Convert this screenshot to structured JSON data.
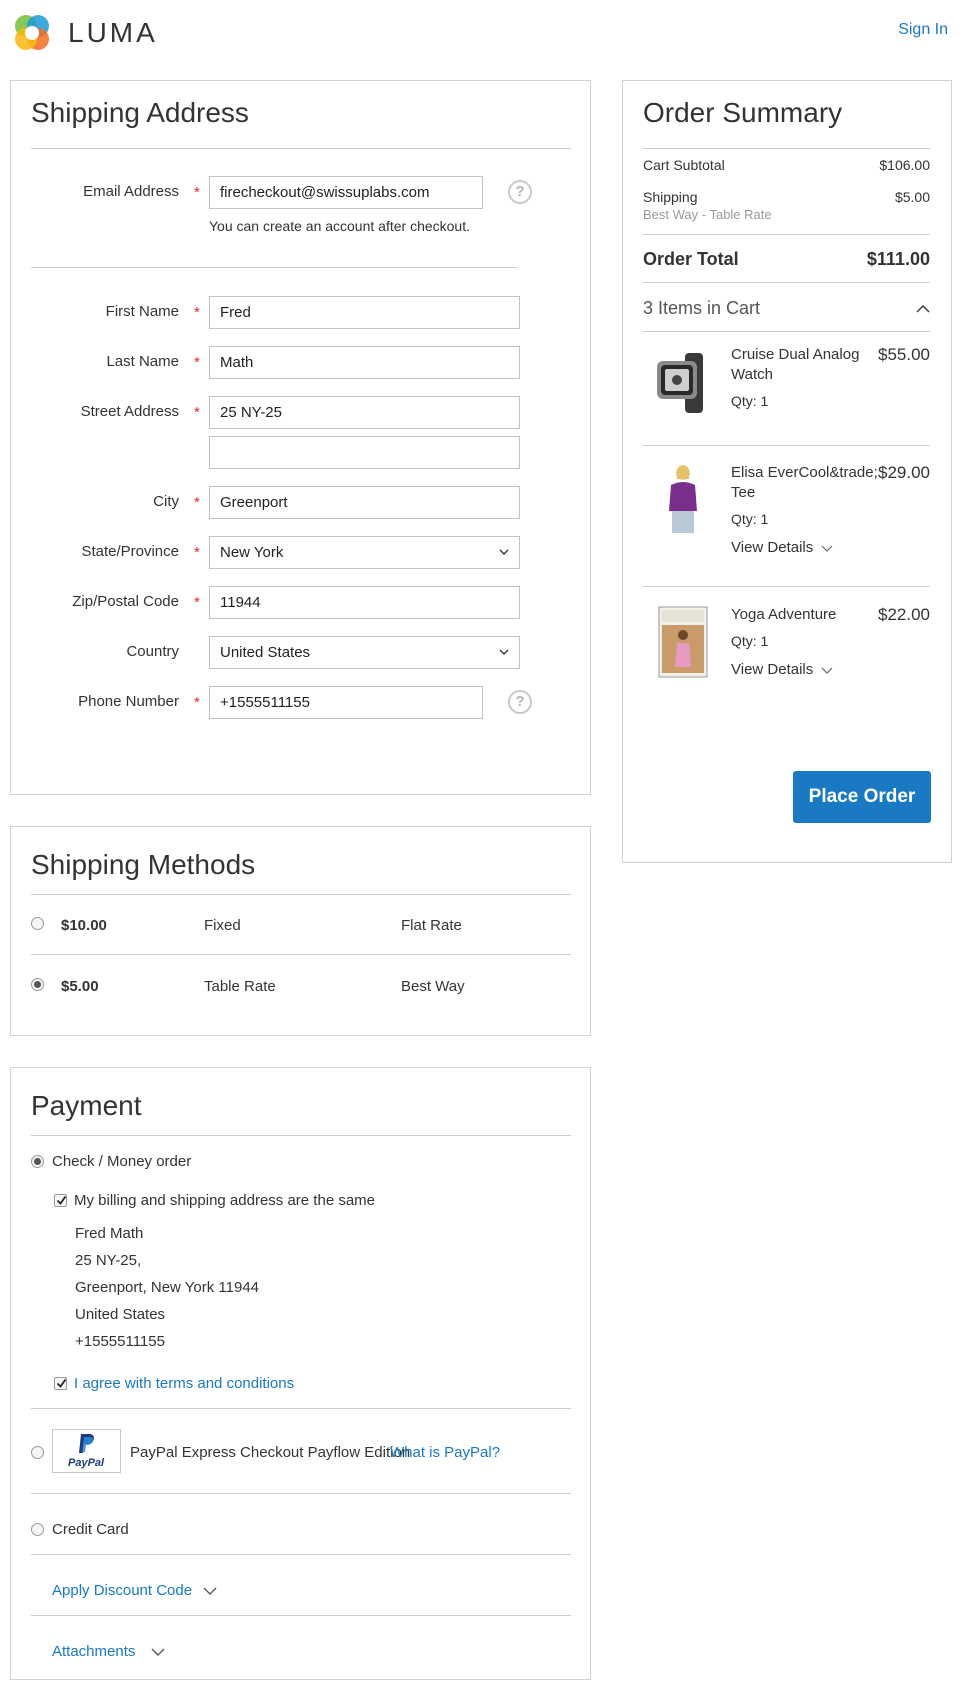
{
  "header": {
    "logo_text": "LUMA",
    "sign_in": "Sign In"
  },
  "colors": {
    "accent": "#1979c3",
    "required": "#e02b27",
    "border": "#d1d1d1"
  },
  "shipping_address": {
    "title": "Shipping Address",
    "email": {
      "label": "Email Address",
      "value": "firecheckout@swissuplabs.com",
      "note": "You can create an account after checkout."
    },
    "first_name": {
      "label": "First Name",
      "value": "Fred"
    },
    "last_name": {
      "label": "Last Name",
      "value": "Math"
    },
    "street": {
      "label": "Street Address",
      "value": "25 NY-25",
      "value2": ""
    },
    "city": {
      "label": "City",
      "value": "Greenport"
    },
    "state": {
      "label": "State/Province",
      "value": "New York"
    },
    "zip": {
      "label": "Zip/Postal Code",
      "value": "11944"
    },
    "country": {
      "label": "Country",
      "value": "United States"
    },
    "phone": {
      "label": "Phone Number",
      "value": "+1555511155"
    },
    "required_mark": "*",
    "help_mark": "?"
  },
  "shipping_methods": {
    "title": "Shipping Methods",
    "methods": [
      {
        "price": "$10.00",
        "method": "Fixed",
        "carrier": "Flat Rate",
        "selected": false
      },
      {
        "price": "$5.00",
        "method": "Table Rate",
        "carrier": "Best Way",
        "selected": true
      }
    ]
  },
  "payment": {
    "title": "Payment",
    "check_money": "Check / Money order",
    "billing_same": "My billing and shipping address are the same",
    "address_lines": [
      "Fred Math",
      "25 NY-25,",
      "Greenport, New York 11944",
      "United States",
      "+1555511155"
    ],
    "terms": "I agree with terms and conditions",
    "paypal_label": "PayPal Express Checkout Payflow Edition",
    "paypal_link": "What is PayPal?",
    "paypal_logo_text": "PayPal",
    "credit_card": "Credit Card",
    "discount": "Apply Discount Code",
    "attachments": "Attachments"
  },
  "order_summary": {
    "title": "Order Summary",
    "cart_subtotal_label": "Cart Subtotal",
    "cart_subtotal": "$106.00",
    "shipping_label": "Shipping",
    "shipping_value": "$5.00",
    "shipping_method": "Best Way - Table Rate",
    "order_total_label": "Order Total",
    "order_total": "$111.00",
    "items_in_cart": "3 Items in Cart",
    "items": [
      {
        "name": "Cruise Dual Analog Watch",
        "price": "$55.00",
        "qty": "Qty: 1",
        "icon": "watch-thumbnail"
      },
      {
        "name": "Elisa EverCool&trade; Tee",
        "price": "$29.00",
        "qty": "Qty: 1",
        "details": "View Details",
        "icon": "tee-thumbnail"
      },
      {
        "name": "Yoga Adventure",
        "price": "$22.00",
        "qty": "Qty: 1",
        "details": "View Details",
        "icon": "dvd-thumbnail"
      }
    ],
    "place_order": "Place Order"
  }
}
